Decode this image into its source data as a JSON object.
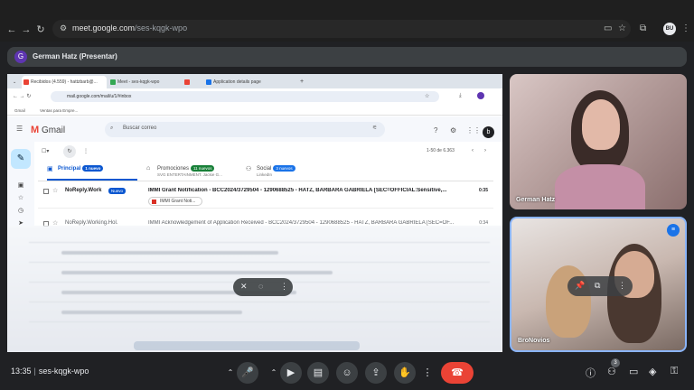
{
  "browser": {
    "url_host": "meet.google.com",
    "url_path": "/ses-kqgk-wpo",
    "profile_initials": "BU"
  },
  "presenter": {
    "initial": "G",
    "label": "German Hatz (Presentar)"
  },
  "shared_screen": {
    "tabs": [
      {
        "label": "Recibidos (4.559) - hattzbarb@...",
        "favicon_color": "#ea4335"
      },
      {
        "label": "Meet - ses-kqgk-wpo",
        "favicon_color": "#34a853"
      },
      {
        "label": "",
        "favicon_color": "#ea4335"
      },
      {
        "label": "Application details page",
        "favicon_color": "#1a73e8"
      }
    ],
    "address": "mail.google.com/mail/u/1/#inbox",
    "bookmarks": [
      "Gmail",
      "Ventas para Empre..."
    ],
    "gmail": {
      "brand": "Gmail",
      "search_placeholder": "Buscar correo",
      "account_initial": "b",
      "count_label": "1-50 de 6.363",
      "categories": [
        {
          "label": "Principal",
          "badge": "1 nuevo",
          "badge_color": "#0b57d0",
          "sub": ""
        },
        {
          "label": "Promociones",
          "badge": "11 nuevos",
          "badge_color": "#188038",
          "sub": "SVG ENTERTAINMENT. Jackie G..."
        },
        {
          "label": "Social",
          "badge": "3 nuevos",
          "badge_color": "#1a73e8",
          "sub": "LinkedIn"
        }
      ],
      "rows": [
        {
          "sender": "NoReply.Work",
          "tag": "Nuevo",
          "subject": "IMMI Grant Notification - BCC2024/3729504 - 1290688525 - HATZ, BARBARA GABRIELA [SEC=OFFICIAL:Sensitive,...",
          "date": "0:35",
          "chip": "IMMI Grant Noti...",
          "read": false
        },
        {
          "sender": "NoReply.Working.Hol.",
          "tag": "",
          "subject": "IMMI Acknowledgement of Application Received - BCC2024/3729504 - 1290688525 - HATZ, BARBARA GABRIELA [SEC=OF...",
          "date": "0:34",
          "chip": "",
          "read": true
        }
      ]
    }
  },
  "participants": [
    {
      "name": "German Hatz"
    },
    {
      "name": "BroNovios"
    }
  ],
  "meeting": {
    "time": "13:35",
    "code": "ses-kqgk-wpo",
    "people_count": "3"
  }
}
